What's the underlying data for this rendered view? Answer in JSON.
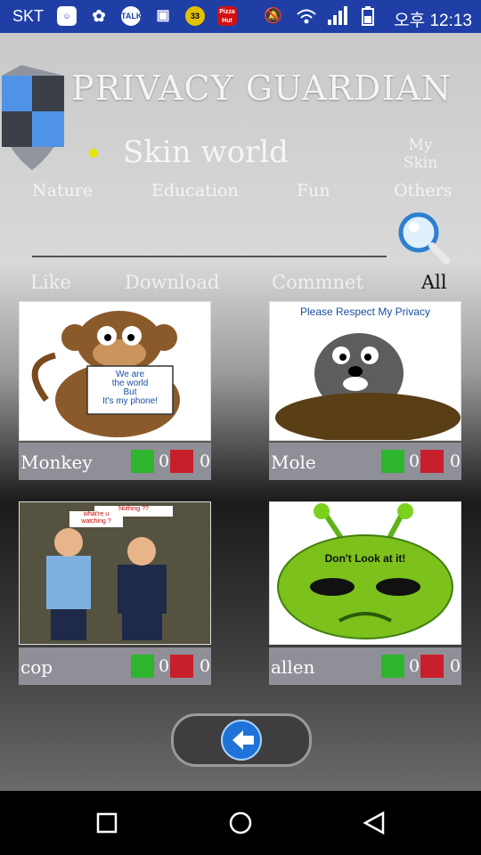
{
  "status": {
    "carrier": "SKT",
    "time": "오후 12:13",
    "icons": [
      "talk-icon",
      "pizza-icon"
    ]
  },
  "header": {
    "title": "PRIVACY GUARDIAN",
    "subtitle": "Skin world",
    "my_skin_line1": "My",
    "my_skin_line2": "Skin"
  },
  "categories": [
    "Nature",
    "Education",
    "Fun",
    "Others"
  ],
  "filters": [
    "Like",
    "Download",
    "Commnet",
    "All"
  ],
  "cards": [
    {
      "name": "Monkey",
      "likes": "0",
      "dislikes": "0",
      "caption1": "We are",
      "caption2": "the world",
      "caption3": "But",
      "caption4": "It's my phone!"
    },
    {
      "name": "Mole",
      "likes": "0",
      "dislikes": "0",
      "caption1": "Please Respect My Privacy"
    },
    {
      "name": "cop",
      "likes": "0",
      "dislikes": "0",
      "caption1": "Nothing ??",
      "caption2": "what're u",
      "caption3": "watching ?"
    },
    {
      "name": "allen",
      "likes": "0",
      "dislikes": "0",
      "caption1": "Don't Look at it!"
    }
  ],
  "sb_talk": "TALK",
  "sb_pizza": "Pizza Hut",
  "sb_33": "33"
}
